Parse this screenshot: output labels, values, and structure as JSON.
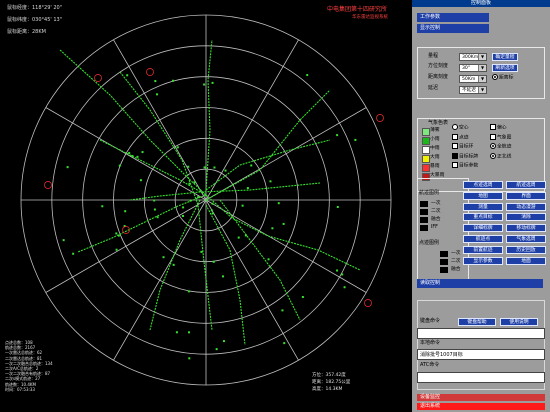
{
  "radar": {
    "title": "中电集团第十四研究所",
    "subtitle": "华东雷达监视系统",
    "coords": [
      "鼠标经度：118°29' 20\"",
      "鼠标纬度：030°45' 13\"",
      "鼠标距离：28KM"
    ],
    "status_lines": [
      "点迹总数：108",
      "航迹总数：2167",
      "一次雷达总航迹：62",
      "二次雷达总航迹：81",
      "一次二次融合总航迹：134",
      "二次A/C总航迹：2",
      "一次二次融合有航迹：87",
      "二次s模式航迹：27",
      "航迹数：10.4KM",
      "时间：07:53:33"
    ],
    "bottom_right": [
      "方位：357.42度",
      "距离：182.75公里",
      "高度：14.3KM"
    ],
    "colors": {
      "background": "#000000",
      "grid": "#bfbfbf",
      "trail": "#36e22e",
      "track_label": "#bfe8bf",
      "title": "#ff4040"
    }
  },
  "panel": {
    "title": "控制面板",
    "work_params": "工作参数",
    "display_ctrl": "显示控制",
    "range_label": "量程",
    "range_value": "300Km",
    "range_btn": "确定量程",
    "azimuth_label": "方位刻度",
    "azimuth_value": "30°",
    "redraw_btn": "刷新选项",
    "dist_label": "距离刻度",
    "dist_value": "50Km",
    "dist_mark": "距离标",
    "delay_label": "延迟",
    "delay_value": "不延迟",
    "weather_title": "气象色表",
    "weather": [
      {
        "name": "薄雾",
        "color": "#7ee87e"
      },
      {
        "name": "小雨",
        "color": "#18b818"
      },
      {
        "name": "中雨",
        "color": "#ffffff"
      },
      {
        "name": "大雨",
        "color": "#f0f000"
      },
      {
        "name": "暴雨",
        "color": "#ff3030"
      },
      {
        "name": "大暴雨",
        "color": "#c01818"
      }
    ],
    "options": [
      {
        "label": "空心",
        "on": false,
        "kind": "radio"
      },
      {
        "label": "偏心",
        "on": false,
        "kind": "box"
      },
      {
        "label": "点迹",
        "on": false,
        "kind": "box"
      },
      {
        "label": "气象图",
        "on": false,
        "kind": "box"
      },
      {
        "label": "目标环",
        "on": false,
        "kind": "box"
      },
      {
        "label": "全航迹",
        "on": true,
        "kind": "radio"
      },
      {
        "label": "目标标牌",
        "on": true,
        "kind": "box"
      },
      {
        "label": "正北线",
        "on": true,
        "kind": "radio"
      },
      {
        "label": "目标参数",
        "on": false,
        "kind": "box"
      }
    ],
    "btn_grid": [
      [
        "点迹选周",
        "航迹选周"
      ],
      [
        "地图",
        "界面"
      ],
      [
        "测量",
        "动态漫游"
      ],
      [
        "重点目标",
        "清除"
      ],
      [
        "详细标牌",
        "移动标牌"
      ],
      [
        "航迹点",
        "气象选周"
      ],
      [
        "前置航迹",
        "历史回放"
      ],
      [
        "显示参数",
        "地面"
      ]
    ],
    "track_legend_title": "航迹图例",
    "track_legend": [
      "一次",
      "二次",
      "融合",
      "IFF"
    ],
    "plot_legend_title": "点迹图例",
    "plot_legend": [
      "一次",
      "二次",
      "融合"
    ],
    "read_ctrl": "读取控制",
    "kbd_cmd": "键盘命令",
    "kbd_help": "键盘帮助",
    "usage": "使用说明",
    "local_cmd": "本地命令",
    "local_value": "消除批号1007目标",
    "atc_cmd": "ATC命令",
    "equip_monitor": "设备监控",
    "exit": "退出系统"
  }
}
